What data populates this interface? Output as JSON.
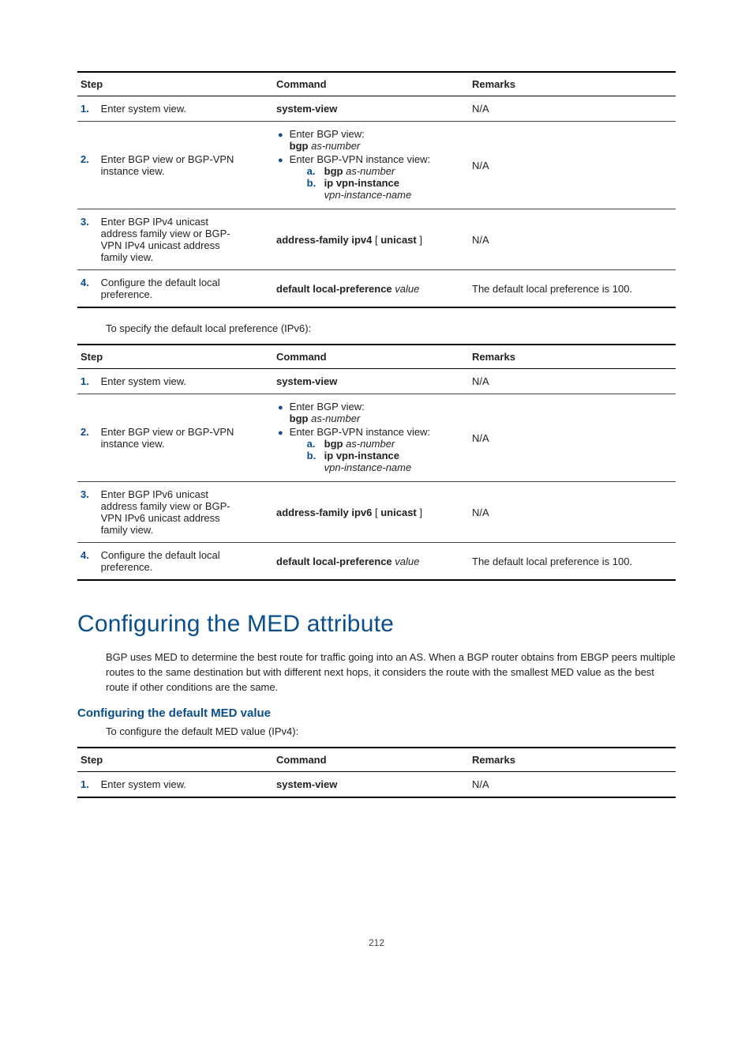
{
  "page_number": "212",
  "tables": {
    "ipv4_pref": {
      "headers": {
        "step": "Step",
        "command": "Command",
        "remarks": "Remarks"
      },
      "rows": [
        {
          "num": "1.",
          "step": "Enter system view.",
          "cmd_bold": "system-view",
          "remarks": "N/A"
        },
        {
          "num": "2.",
          "step": "Enter BGP view or BGP-VPN instance view.",
          "bullets": [
            {
              "text": "Enter BGP view:",
              "line2_bold": "bgp",
              "line2_it": "as-number"
            },
            {
              "text": "Enter BGP-VPN instance view:",
              "sub": [
                {
                  "label": "a.",
                  "bold": "bgp",
                  "it": "as-number"
                },
                {
                  "label": "b.",
                  "bold": "ip vpn-instance",
                  "it_line2": "vpn-instance-name"
                }
              ]
            }
          ],
          "remarks": "N/A"
        },
        {
          "num": "3.",
          "step": "Enter BGP IPv4 unicast address family view or BGP-VPN IPv4 unicast address family view.",
          "cmd_bold": "address-family ipv4",
          "cmd_plain": " [ ",
          "cmd_bold2": "unicast",
          "cmd_plain2": " ]",
          "remarks": "N/A"
        },
        {
          "num": "4.",
          "step": "Configure the default local preference.",
          "cmd_bold": "default local-preference",
          "cmd_it": " value",
          "remarks": "The default local preference is 100."
        }
      ]
    },
    "ipv6_pref_intro": "To specify the default local preference (IPv6):",
    "ipv6_pref": {
      "headers": {
        "step": "Step",
        "command": "Command",
        "remarks": "Remarks"
      },
      "rows": [
        {
          "num": "1.",
          "step": "Enter system view.",
          "cmd_bold": "system-view",
          "remarks": "N/A"
        },
        {
          "num": "2.",
          "step": "Enter BGP view or BGP-VPN instance view.",
          "bullets": [
            {
              "text": "Enter BGP view:",
              "line2_bold": "bgp",
              "line2_it": "as-number"
            },
            {
              "text": "Enter BGP-VPN instance view:",
              "sub": [
                {
                  "label": "a.",
                  "bold": "bgp",
                  "it": "as-number"
                },
                {
                  "label": "b.",
                  "bold": "ip vpn-instance",
                  "it_line2": "vpn-instance-name"
                }
              ]
            }
          ],
          "remarks": "N/A"
        },
        {
          "num": "3.",
          "step": "Enter BGP IPv6 unicast address family view or BGP-VPN IPv6 unicast address family view.",
          "cmd_bold": "address-family ipv6",
          "cmd_plain": " [ ",
          "cmd_bold2": "unicast",
          "cmd_plain2": " ]",
          "remarks": "N/A"
        },
        {
          "num": "4.",
          "step": "Configure the default local preference.",
          "cmd_bold": "default local-preference",
          "cmd_it": " value",
          "remarks": "The default local preference is 100."
        }
      ]
    }
  },
  "section": {
    "title": "Configuring the MED attribute",
    "body": "BGP uses MED to determine the best route for traffic going into an AS. When a BGP router obtains from EBGP peers multiple routes to the same destination but with different next hops, it considers the route with the smallest MED value as the best route if other conditions are the same.",
    "sub_title": "Configuring the default MED value",
    "sub_intro": "To configure the default MED value (IPv4):"
  },
  "med_table": {
    "headers": {
      "step": "Step",
      "command": "Command",
      "remarks": "Remarks"
    },
    "row1": {
      "num": "1.",
      "step": "Enter system view.",
      "cmd_bold": "system-view",
      "remarks": "N/A"
    }
  }
}
